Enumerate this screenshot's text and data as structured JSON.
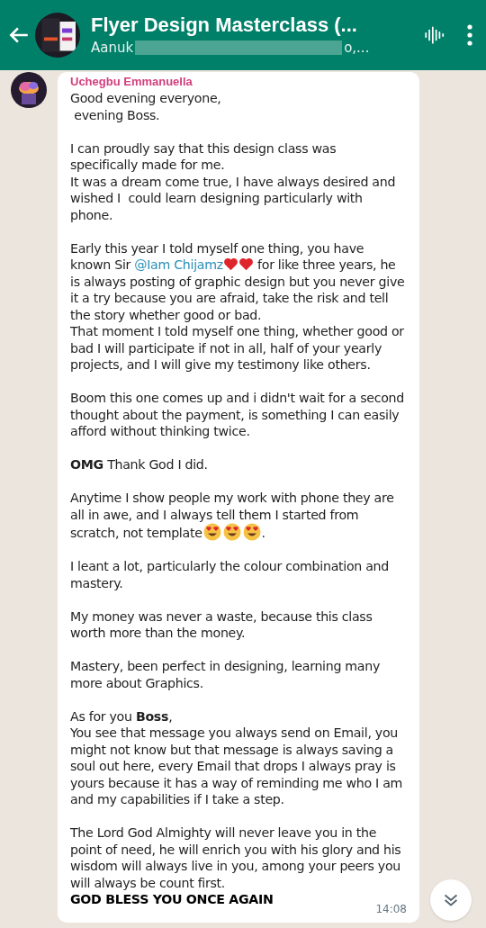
{
  "header": {
    "title": "Flyer Design Masterclass (...",
    "subtitle_start": "Aanuk",
    "subtitle_end": "o,..."
  },
  "message": {
    "sender": "Uchegbu Emmanuella",
    "time": "14:08",
    "paragraphs": [
      [
        {
          "segments": [
            {
              "kind": "text",
              "text": "Good evening everyone,"
            }
          ]
        },
        {
          "segments": [
            {
              "kind": "text",
              "text": " evening Boss."
            }
          ]
        }
      ],
      [
        {
          "segments": [
            {
              "kind": "text",
              "text": "I can proudly say that this design class was specifically made for me."
            }
          ]
        },
        {
          "segments": [
            {
              "kind": "text",
              "text": "It was a dream come true, I have always desired and wished I  could learn designing particularly with phone."
            }
          ]
        }
      ],
      [
        {
          "segments": [
            {
              "kind": "text",
              "text": "Early this year I told myself one thing, you have known Sir "
            },
            {
              "kind": "mention",
              "text": "@Iam Chijamz"
            },
            {
              "kind": "heart"
            },
            {
              "kind": "heart"
            },
            {
              "kind": "text",
              "text": " for like three years, he is always posting of graphic design but you never give it a try because you are afraid, take the risk and tell the story whether good or bad."
            }
          ]
        },
        {
          "segments": [
            {
              "kind": "text",
              "text": "That moment I told myself one thing, whether good or bad I will participate if not in all, half of your yearly projects, and I will give my testimony like others."
            }
          ]
        }
      ],
      [
        {
          "segments": [
            {
              "kind": "text",
              "text": "Boom this one comes up and i didn't wait for a second thought about the payment, is something I can easily afford without thinking twice."
            }
          ]
        }
      ],
      [
        {
          "segments": [
            {
              "kind": "text",
              "text": "**OMG** Thank God I did."
            }
          ]
        }
      ],
      [
        {
          "segments": [
            {
              "kind": "text",
              "text": "Anytime I show people my work with phone they are all in awe, and I always tell them I started from scratch, not template"
            },
            {
              "kind": "smiley"
            },
            {
              "kind": "smiley"
            },
            {
              "kind": "smiley"
            },
            {
              "kind": "text",
              "text": "."
            }
          ]
        }
      ],
      [
        {
          "segments": [
            {
              "kind": "text",
              "text": "I leant a lot, particularly the colour combination and mastery."
            }
          ]
        }
      ],
      [
        {
          "segments": [
            {
              "kind": "text",
              "text": "My money was never a waste, because this class worth more than the money."
            }
          ]
        }
      ],
      [
        {
          "segments": [
            {
              "kind": "text",
              "text": "Mastery, been perfect in designing, learning many more about Graphics."
            }
          ]
        }
      ],
      [
        {
          "segments": [
            {
              "kind": "text",
              "text": "As for you **Boss**,"
            }
          ]
        },
        {
          "segments": [
            {
              "kind": "text",
              "text": "You see that message you always send on Email, you might not know but that message is always saving a soul out here, every Email that drops I always pray is yours because it has a way of reminding me who I am and my capabilities if I take a step."
            }
          ]
        }
      ],
      [
        {
          "segments": [
            {
              "kind": "text",
              "text": "The Lord God Almighty will never leave you in the point of need, he will enrich you with his glory and his wisdom will always live in you, among your peers you will always be count first."
            }
          ]
        },
        {
          "bold": true,
          "segments": [
            {
              "kind": "text",
              "text": "GOD BLESS YOU ONCE AGAIN"
            }
          ]
        }
      ]
    ]
  }
}
